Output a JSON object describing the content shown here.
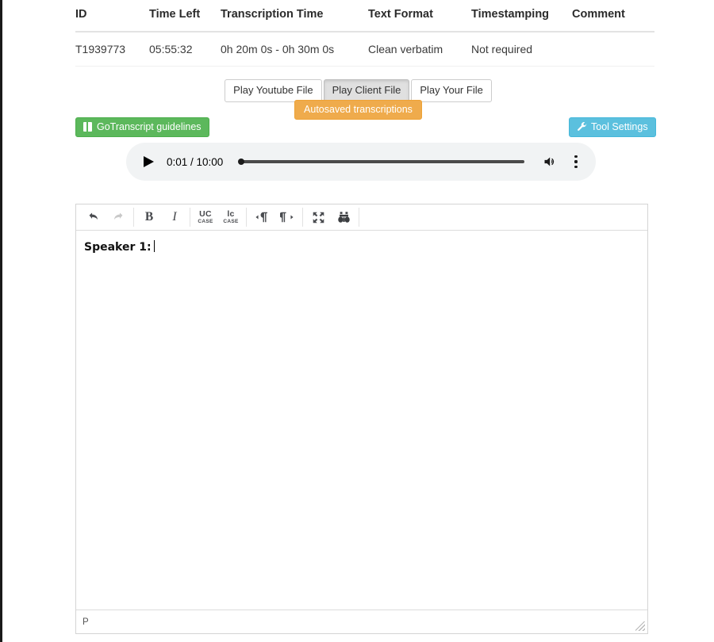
{
  "job_table": {
    "columns": [
      "ID",
      "Time Left",
      "Transcription Time",
      "Text Format",
      "Timestamping",
      "Comment"
    ],
    "rows": [
      {
        "id": "T1939773",
        "time_left": "05:55:32",
        "transcription_time": "0h 20m 0s - 0h 30m 0s",
        "text_format": "Clean verbatim",
        "timestamping": "Not required",
        "comment": ""
      }
    ]
  },
  "play_buttons": [
    {
      "label": "Play Youtube File",
      "active": false
    },
    {
      "label": "Play Client File",
      "active": true
    },
    {
      "label": "Play Your File",
      "active": false
    }
  ],
  "autosave": {
    "label": "Autosaved transcriptions",
    "color": "#efab4c"
  },
  "guidelines": {
    "label": "GoTranscript guidelines",
    "icon": "book-icon",
    "color": "#5cb85c"
  },
  "tool_settings": {
    "label": "Tool Settings",
    "icon": "wrench-icon",
    "color": "#5bc0de"
  },
  "audio_player": {
    "play_icon": "play-icon",
    "time_display": "0:01 / 10:00",
    "current_time": "0:01",
    "duration": "10:00",
    "volume_icon": "volume-icon",
    "menu_icon": "more-vertical-icon",
    "progress_percent": 0
  },
  "editor": {
    "toolbar": [
      {
        "name": "undo",
        "icon": "undo-icon",
        "disabled": false
      },
      {
        "name": "redo",
        "icon": "redo-icon",
        "disabled": true
      },
      {
        "name": "bold",
        "label": "B"
      },
      {
        "name": "italic",
        "label": "I"
      },
      {
        "name": "uppercase",
        "line1": "UC",
        "line2": "CASE"
      },
      {
        "name": "lowercase",
        "line1": "lc",
        "line2": "CASE"
      },
      {
        "name": "paragraph-ltr",
        "icon": "paragraph-ltr-icon"
      },
      {
        "name": "paragraph-rtl",
        "icon": "paragraph-rtl-icon"
      },
      {
        "name": "fullscreen",
        "icon": "fullscreen-icon"
      },
      {
        "name": "find",
        "icon": "binoculars-icon"
      }
    ],
    "content": "Speaker 1:",
    "status_path": "P"
  }
}
